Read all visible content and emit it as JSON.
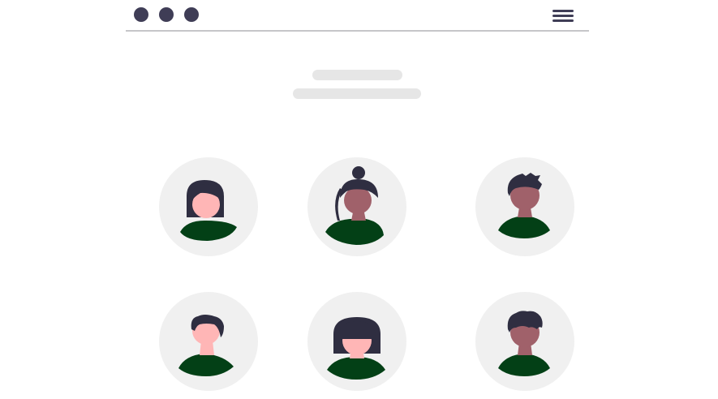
{
  "header": {
    "window_dots": [
      "dot",
      "dot",
      "dot"
    ],
    "menu_icon": "hamburger-menu-icon"
  },
  "placeholders": {
    "heading": "",
    "subheading": ""
  },
  "avatars": [
    {
      "hair": "bob-bangs",
      "skin": "#ffb6b6",
      "shirt": "#034016"
    },
    {
      "hair": "bun",
      "skin": "#a0616a",
      "shirt": "#034016"
    },
    {
      "hair": "short-quiff",
      "skin": "#a0616a",
      "shirt": "#034016"
    },
    {
      "hair": "short-side",
      "skin": "#ffb6b6",
      "shirt": "#034016"
    },
    {
      "hair": "bob-bangs",
      "skin": "#ffb6b6",
      "shirt": "#034016"
    },
    {
      "hair": "short-curly",
      "skin": "#a0616a",
      "shirt": "#034016"
    }
  ],
  "colors": {
    "dark": "#3f3d56",
    "circle_bg": "#f0f0f0",
    "placeholder": "#e6e6e6",
    "divider": "#c6c6c9",
    "hair": "#2f2e41"
  }
}
